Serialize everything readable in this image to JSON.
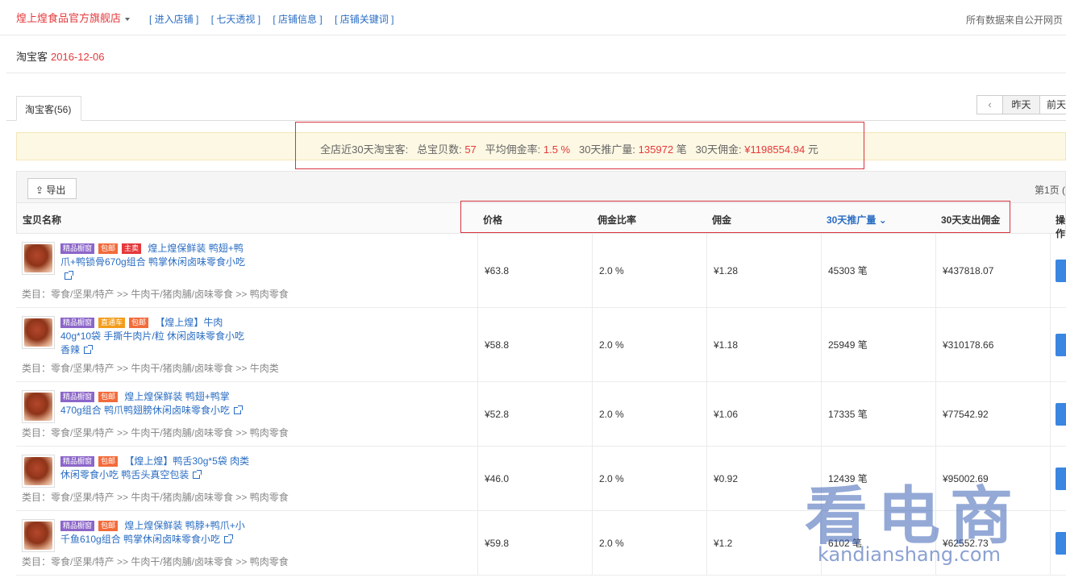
{
  "header": {
    "shop_name": "煌上煌食品官方旗舰店",
    "links": [
      "[ 进入店铺 ]",
      "[ 七天透视 ]",
      "[ 店铺信息 ]",
      "[ 店铺关键词 ]"
    ],
    "source_note": "所有数据来自公开网页"
  },
  "subheader": {
    "label": "淘宝客",
    "date": "2016-12-06"
  },
  "tabs": [
    {
      "label": "淘宝客(56)"
    }
  ],
  "day_nav": {
    "prev": "‹",
    "yesterday": "昨天",
    "day_before": "前天"
  },
  "summary": {
    "prefix": "全店近30天淘宝客:",
    "items_label": "总宝贝数:",
    "items_value": "57",
    "rate_label": "平均佣金率:",
    "rate_value": "1.5 %",
    "promo_label": "30天推广量:",
    "promo_value": "135972",
    "promo_unit": "笔",
    "comm_label": "30天佣金:",
    "comm_value": "¥1198554.94",
    "comm_unit": "元"
  },
  "toolbar": {
    "export_label": "导出",
    "page_info": "第1页 ("
  },
  "table": {
    "headers": [
      "宝贝名称",
      "价格",
      "佣金比率",
      "佣金",
      "30天推广量",
      "30天支出佣金",
      "操作"
    ],
    "rows": [
      {
        "tags": [
          "精品橱窗",
          "包邮",
          "主卖"
        ],
        "title_lines": [
          "煌上煌保鲜装 鸭翅+鸭",
          "爪+鸭锁骨670g组合 鸭掌休闲卤味零食小吃",
          ""
        ],
        "category": "类目：零食/坚果/特产 >> 牛肉干/猪肉脯/卤味零食 >> 鸭肉零食",
        "price": "¥63.8",
        "rate": "2.0 %",
        "commission": "¥1.28",
        "promo": "45303 笔",
        "paid": "¥437818.07"
      },
      {
        "tags": [
          "精品橱窗",
          "直通车",
          "包邮"
        ],
        "title_lines": [
          "【煌上煌】牛肉",
          "40g*10袋 手撕牛肉片/粒 休闲卤味零食小吃",
          "香辣"
        ],
        "category": "类目：零食/坚果/特产 >> 牛肉干/猪肉脯/卤味零食 >> 牛肉类",
        "price": "¥58.8",
        "rate": "2.0 %",
        "commission": "¥1.18",
        "promo": "25949 笔",
        "paid": "¥310178.66"
      },
      {
        "tags": [
          "精品橱窗",
          "包邮"
        ],
        "title_lines": [
          "煌上煌保鲜装 鸭翅+鸭掌",
          "470g组合 鸭爪鸭翅膀休闲卤味零食小吃"
        ],
        "category": "类目：零食/坚果/特产 >> 牛肉干/猪肉脯/卤味零食 >> 鸭肉零食",
        "price": "¥52.8",
        "rate": "2.0 %",
        "commission": "¥1.06",
        "promo": "17335 笔",
        "paid": "¥77542.92"
      },
      {
        "tags": [
          "精品橱窗",
          "包邮"
        ],
        "title_lines": [
          "【煌上煌】鸭舌30g*5袋 肉类",
          "休闲零食小吃 鸭舌头真空包装"
        ],
        "category": "类目：零食/坚果/特产 >> 牛肉干/猪肉脯/卤味零食 >> 鸭肉零食",
        "price": "¥46.0",
        "rate": "2.0 %",
        "commission": "¥0.92",
        "promo": "12439 笔",
        "paid": "¥95002.69"
      },
      {
        "tags": [
          "精品橱窗",
          "包邮"
        ],
        "title_lines": [
          "煌上煌保鲜装 鸭脖+鸭爪+小",
          "千鱼610g组合 鸭掌休闲卤味零食小吃"
        ],
        "category": "类目：零食/坚果/特产 >> 牛肉干/猪肉脯/卤味零食 >> 鸭肉零食",
        "price": "¥59.8",
        "rate": "2.0 %",
        "commission": "¥1.2",
        "promo": "6102 笔",
        "paid": "¥62552.73"
      }
    ]
  },
  "watermark": {
    "text": "看电商",
    "url": "kandianshang.com"
  }
}
